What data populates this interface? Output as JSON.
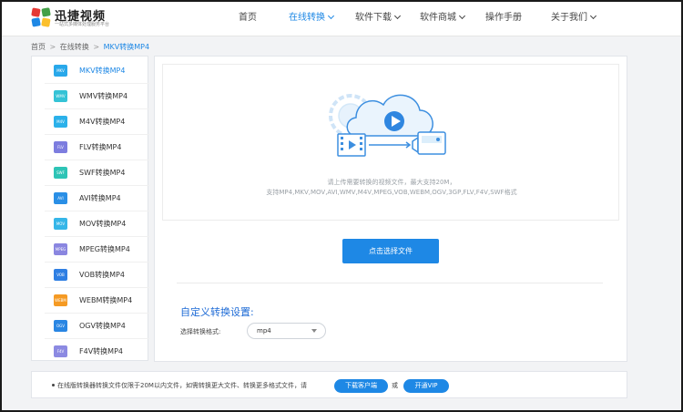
{
  "header": {
    "logo_title": "迅捷视频",
    "logo_subtitle": "一站式多媒体处理服务平台",
    "nav": [
      {
        "label": "首页",
        "dropdown": false,
        "active": false
      },
      {
        "label": "在线转换",
        "dropdown": true,
        "active": true
      },
      {
        "label": "软件下载",
        "dropdown": true,
        "active": false
      },
      {
        "label": "软件商城",
        "dropdown": true,
        "active": false
      },
      {
        "label": "操作手册",
        "dropdown": false,
        "active": false
      },
      {
        "label": "关于我们",
        "dropdown": true,
        "active": false
      }
    ]
  },
  "breadcrumb": {
    "items": [
      "首页",
      "在线转换",
      "MKV转换MP4"
    ],
    "separator": ">"
  },
  "sidebar": {
    "items": [
      {
        "icon_text": "MKV",
        "label": "MKV转换MP4",
        "color": "#29a8ea",
        "active": true
      },
      {
        "icon_text": "WMV",
        "label": "WMV转换MP4",
        "color": "#35c3d6",
        "active": false
      },
      {
        "icon_text": "M4V",
        "label": "M4V转换MP4",
        "color": "#2bb1ea",
        "active": false
      },
      {
        "icon_text": "FLV",
        "label": "FLV转换MP4",
        "color": "#7d7ddf",
        "active": false
      },
      {
        "icon_text": "SWF",
        "label": "SWF转换MP4",
        "color": "#2ec4b6",
        "active": false
      },
      {
        "icon_text": "AVI",
        "label": "AVI转换MP4",
        "color": "#2a8fe6",
        "active": false
      },
      {
        "icon_text": "MOV",
        "label": "MOV转换MP4",
        "color": "#35b6e8",
        "active": false
      },
      {
        "icon_text": "MPEG",
        "label": "MPEG转换MP4",
        "color": "#8a86e0",
        "active": false
      },
      {
        "icon_text": "VOB",
        "label": "VOB转换MP4",
        "color": "#2f7fe3",
        "active": false
      },
      {
        "icon_text": "WEBM",
        "label": "WEBM转换MP4",
        "color": "#f59a23",
        "active": false
      },
      {
        "icon_text": "OGV",
        "label": "OGV转换MP4",
        "color": "#2a86e3",
        "active": false
      },
      {
        "icon_text": "F4V",
        "label": "F4V转换MP4",
        "color": "#8c8ae2",
        "active": false
      }
    ]
  },
  "upload": {
    "hint_line1": "请上传需要转换的视频文件，最大支持20M，",
    "hint_line2": "支持MP4,MKV,MOV,AVI,WMV,M4V,MPEG,VOB,WEBM,OGV,3GP,FLV,F4V,SWF格式",
    "choose_button": "点击选择文件"
  },
  "settings": {
    "title": "自定义转换设置:",
    "format_label": "选择转换格式:",
    "format_value": "mp4"
  },
  "notice": {
    "text": "在线版转换器转换文件仅限于20M以内文件，如需转换更大文件、转换更多格式文件，请",
    "download_button": "下载客户端",
    "or_text": "或",
    "vip_button": "开通VIP"
  },
  "colors": {
    "accent": "#1e88e5",
    "settings_title": "#1e6bd6",
    "art_light": "#dceefb",
    "art_stroke": "#3d8fe0"
  }
}
